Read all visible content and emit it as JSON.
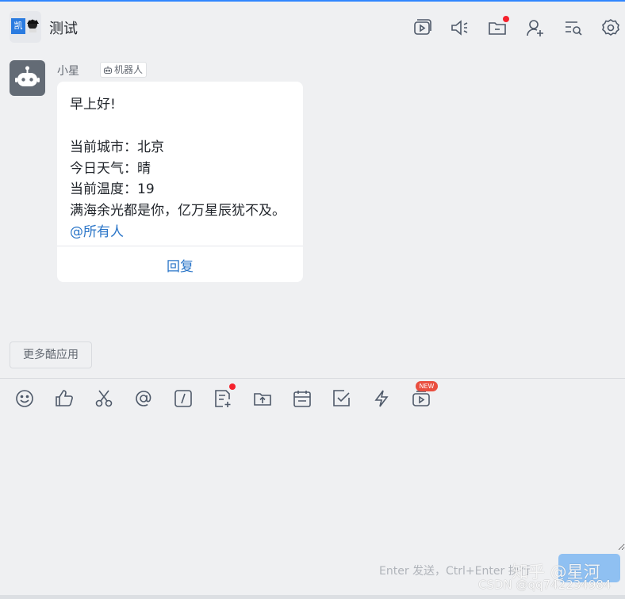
{
  "header": {
    "group_avatar_text": "凯",
    "title": "测试",
    "icons": [
      "video-icon",
      "speaker-icon",
      "folder-icon",
      "add-member-icon",
      "search-history-icon",
      "gear-icon"
    ]
  },
  "message": {
    "sender": "小星",
    "tag": "机器人",
    "lines": {
      "greeting": "早上好!",
      "city": "当前城市：北京",
      "weather": "今日天气：晴",
      "temperature": "当前温度：19",
      "quote": "满海余光都是你，亿万星辰犹不及。",
      "mention": "@所有人"
    },
    "reply_label": "回复"
  },
  "apps": {
    "label": "更多酷应用"
  },
  "toolbar": {
    "icons": [
      "emoji-icon",
      "thumbs-up-icon",
      "scissors-icon",
      "at-icon",
      "slash-command-icon",
      "add-doc-icon",
      "upload-file-icon",
      "calendar-icon",
      "task-check-icon",
      "lightning-icon",
      "video-play-icon"
    ],
    "new_badge": "NEW"
  },
  "composer": {
    "hint": "Enter 发送，Ctrl+Enter 换行",
    "watermark_zhihu": "知乎 @星河",
    "watermark_csdn": "CSDN @qq742234984"
  },
  "colors": {
    "accent": "#2a75c8",
    "badge": "#f5222d",
    "send": "#8fc0f2"
  }
}
